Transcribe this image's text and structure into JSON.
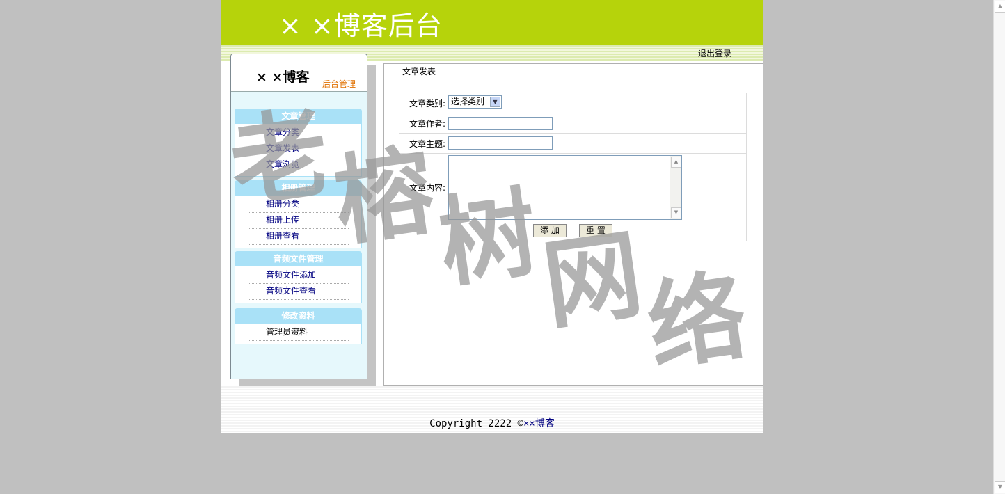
{
  "header": {
    "title": "× ×博客后台",
    "logout": "退出登录"
  },
  "sidebar": {
    "brand": "× ×博客",
    "subtitle": "后台管理",
    "groups": [
      {
        "title": "文章管理",
        "items": [
          "文章分类",
          "文章发表",
          "文章浏览"
        ]
      },
      {
        "title": "相册管理",
        "items": [
          "相册分类",
          "相册上传",
          "相册查看"
        ]
      },
      {
        "title": "音频文件管理",
        "items": [
          "音频文件添加",
          "音频文件查看"
        ]
      },
      {
        "title": "修改资料",
        "items": [
          "管理员资料"
        ]
      }
    ]
  },
  "content": {
    "title": "文章发表",
    "form": {
      "category_label": "文章类别:",
      "category_value": "选择类别",
      "author_label": "文章作者:",
      "author_value": "",
      "subject_label": "文章主题:",
      "subject_value": "",
      "body_label": "文章内容:",
      "body_value": "",
      "submit_label": "添 加",
      "reset_label": "重 置"
    }
  },
  "footer": {
    "copyright": "Copyright 2222 ©",
    "brand": "××博客"
  },
  "watermark": [
    "老",
    "榕",
    "树",
    "网",
    "络"
  ],
  "colors": {
    "banner": "#b6d30b",
    "nav_header": "#a9e1f7",
    "sidebar_bg": "#e6f8fc",
    "link": "#000080",
    "subtitle": "#e07000"
  }
}
